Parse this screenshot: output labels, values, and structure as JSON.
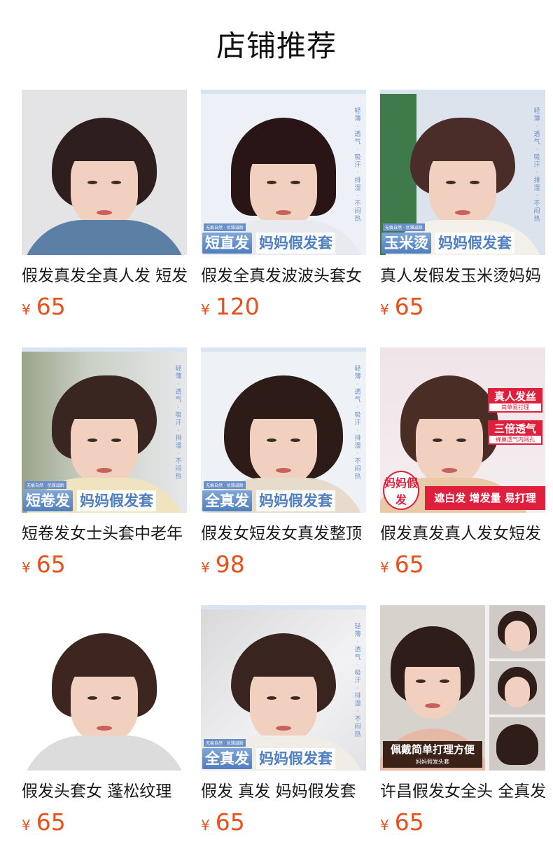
{
  "page_title": "店铺推荐",
  "colors": {
    "price": "#e8501c",
    "badge_red": "#e01f3d",
    "banner_blue": "#4f7fc0"
  },
  "products": [
    {
      "title": "假发真发全真人发 短发",
      "currency": "¥",
      "price": "65"
    },
    {
      "title": "假发全真发波波头套女",
      "currency": "¥",
      "price": "120",
      "banner": {
        "left": "短直发",
        "right": "妈妈假发套",
        "tag": "无痕自然 · 优雅减龄",
        "side": "轻薄 · 透气 · 吸汗 · 排湿 · 不闷热"
      }
    },
    {
      "title": "真人发假发玉米烫妈妈",
      "currency": "¥",
      "price": "65",
      "banner": {
        "left": "玉米烫",
        "right": "妈妈假发套",
        "tag": "无痕自然 · 优雅减龄",
        "side": "轻薄 · 透气 · 吸汗 · 排湿 · 不闷热"
      }
    },
    {
      "title": "短卷发女士头套中老年",
      "currency": "¥",
      "price": "65",
      "banner": {
        "left": "短卷发",
        "right": "妈妈假发套",
        "tag": "无痕自然 · 优雅减龄",
        "side": "轻薄 · 透气 · 吸汗 · 排湿 · 不闷热"
      }
    },
    {
      "title": "假发女短发女真发整顶",
      "currency": "¥",
      "price": "98",
      "banner": {
        "left": "全真发",
        "right": "妈妈假发套",
        "tag": "无痕自然 · 优雅减龄",
        "side": "轻薄 · 透气 · 吸汗 · 排湿 · 不闷热"
      }
    },
    {
      "title": "假发真发真人发女短发",
      "currency": "¥",
      "price": "65",
      "badges": [
        {
          "big": "真人发丝",
          "small": "简单易打理"
        },
        {
          "big": "三倍透气",
          "small": "蜂巢透气内网孔"
        }
      ],
      "circle": "妈妈假发",
      "bar": "遮白发 增发量 易打理"
    },
    {
      "title": "假发头套女 蓬松纹理",
      "currency": "¥",
      "price": "65"
    },
    {
      "title": "假发 真发 妈妈假发套",
      "currency": "¥",
      "price": "65",
      "banner": {
        "left": "全真发",
        "right": "妈妈假发套",
        "tag": "无痕自然 · 优雅减龄",
        "side": "轻薄 · 透气 · 吸汗 · 排湿 · 不闷热"
      }
    },
    {
      "title": "许昌假发女全头 全真发",
      "currency": "¥",
      "price": "65",
      "caption": {
        "line1": "佩戴简单打理方便",
        "line2": "妈妈假发头套"
      }
    }
  ]
}
